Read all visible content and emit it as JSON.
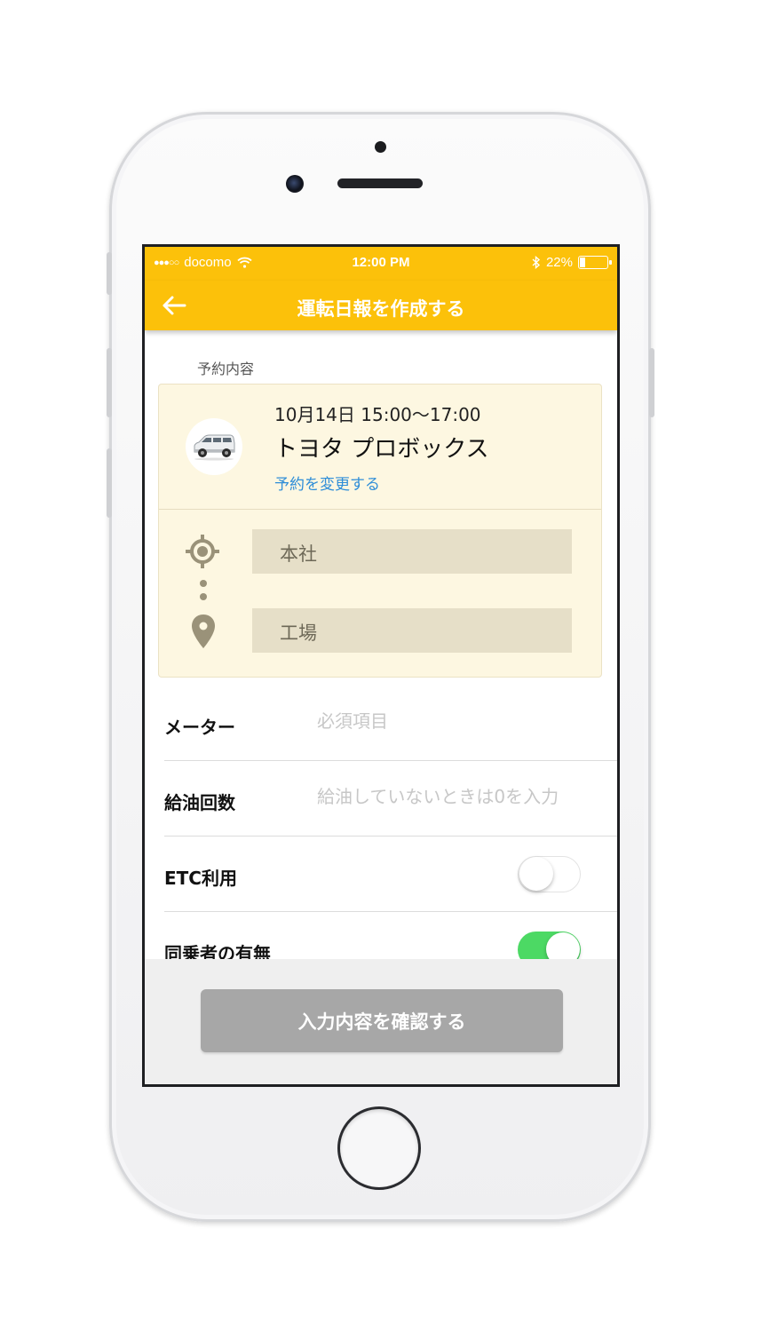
{
  "status_bar": {
    "carrier": "docomo",
    "signal_dots": "●●●○○",
    "time": "12:00 PM",
    "battery": "22%",
    "battery_level": 0.22
  },
  "nav": {
    "title": "運転日報を作成する",
    "back_icon": "arrow-left-icon"
  },
  "reservation": {
    "section_label": "予約内容",
    "datetime": "10月14日 15:00〜17:00",
    "vehicle": "トヨタ プロボックス",
    "change_link": "予約を変更する",
    "origin": "本社",
    "destination": "工場"
  },
  "form": {
    "meter": {
      "label": "メーター",
      "placeholder": "必須項目",
      "value": ""
    },
    "refuel": {
      "label": "給油回数",
      "placeholder": "給油していないときは0を入力",
      "value": ""
    },
    "etc": {
      "label": "ETC利用",
      "enabled": false
    },
    "passenger": {
      "label": "同乗者の有無",
      "enabled": true
    }
  },
  "footer": {
    "confirm_label": "入力内容を確認する"
  },
  "colors": {
    "accent": "#fcc10a",
    "card_bg": "#fdf7e1",
    "link": "#2f8ed8",
    "toggle_on": "#4cd964",
    "button_disabled": "#a7a7a7"
  }
}
